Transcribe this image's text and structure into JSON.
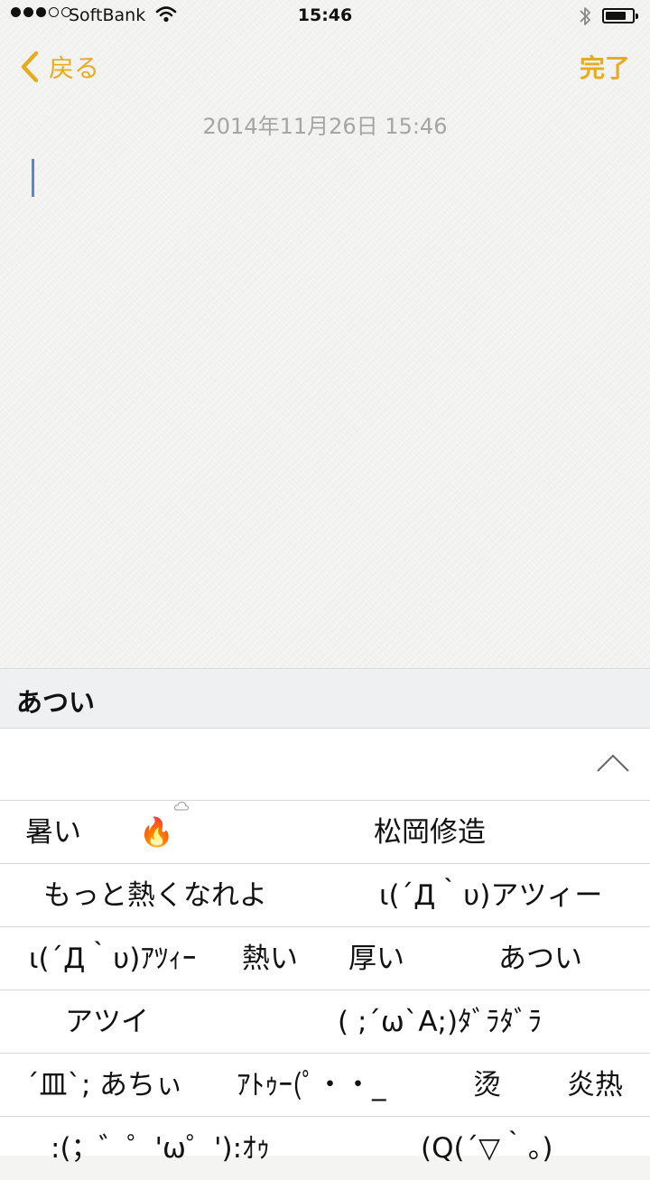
{
  "status_bar": {
    "carrier": "SoftBank",
    "time": "15:46",
    "signal_bars": 3,
    "signal_total": 5,
    "battery_level": 0.8
  },
  "nav": {
    "back_label": "戻る",
    "done_label": "完了",
    "accent_color": "#e6ac20"
  },
  "note": {
    "date": "2014年11月26日 15:46"
  },
  "keyboard": {
    "composing_text": "あつい",
    "candidates": {
      "row1": [
        "暑い",
        "🔥",
        "松岡修造"
      ],
      "row2": [
        "もっと熱くなれよ",
        "ι(´Д｀υ)アツィー"
      ],
      "row3": [
        "ι(´Д｀υ)ｱﾂｨｰ",
        "熱い",
        "厚い",
        "あつい"
      ],
      "row4": [
        "アツイ",
        "( ;´ω`A;)ﾀﾞﾗﾀﾞﾗ"
      ],
      "row5": [
        "´皿`;",
        "あちぃ",
        "ｱﾄｩｰ(ﾟ・・_",
        "烫",
        "炎热"
      ],
      "row6": [
        ":(；゛゜'ω゜'):ｵｩ",
        "(Q(´▽｀。)"
      ]
    }
  }
}
